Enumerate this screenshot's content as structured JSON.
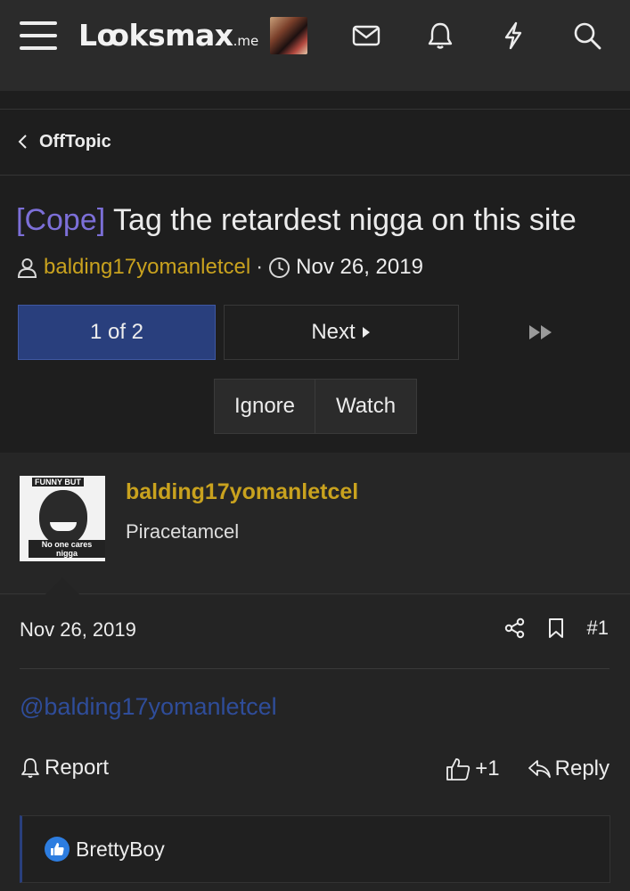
{
  "navbar": {
    "logo_main": "Lꝏksmax",
    "logo_suffix": ".me"
  },
  "breadcrumb": {
    "label": "OffTopic"
  },
  "thread": {
    "prefix": "[Cope]",
    "title": "Tag the retardest nigga on this site",
    "author": "balding17yomanletcel",
    "separator": "·",
    "date": "Nov 26, 2019"
  },
  "pagination": {
    "current": "1 of 2",
    "next_label": "Next"
  },
  "thread_actions": {
    "ignore": "Ignore",
    "watch": "Watch"
  },
  "post": {
    "avatar_caption_top": "FUNNY BUT",
    "avatar_caption_bottom": "No one cares nigga",
    "username": "balding17yomanletcel",
    "user_title": "Piracetamcel",
    "date": "Nov 26, 2019",
    "number": "#1",
    "body_mention": "@balding17yomanletcel",
    "report_label": "Report",
    "like_label": "+1",
    "reply_label": "Reply"
  },
  "reactions": {
    "users": "BrettyBoy"
  },
  "colors": {
    "accent_blue": "#293f7d",
    "username_gold": "#c9a21e",
    "prefix_purple": "#7c6fd8",
    "background": "#1e1e1e"
  }
}
